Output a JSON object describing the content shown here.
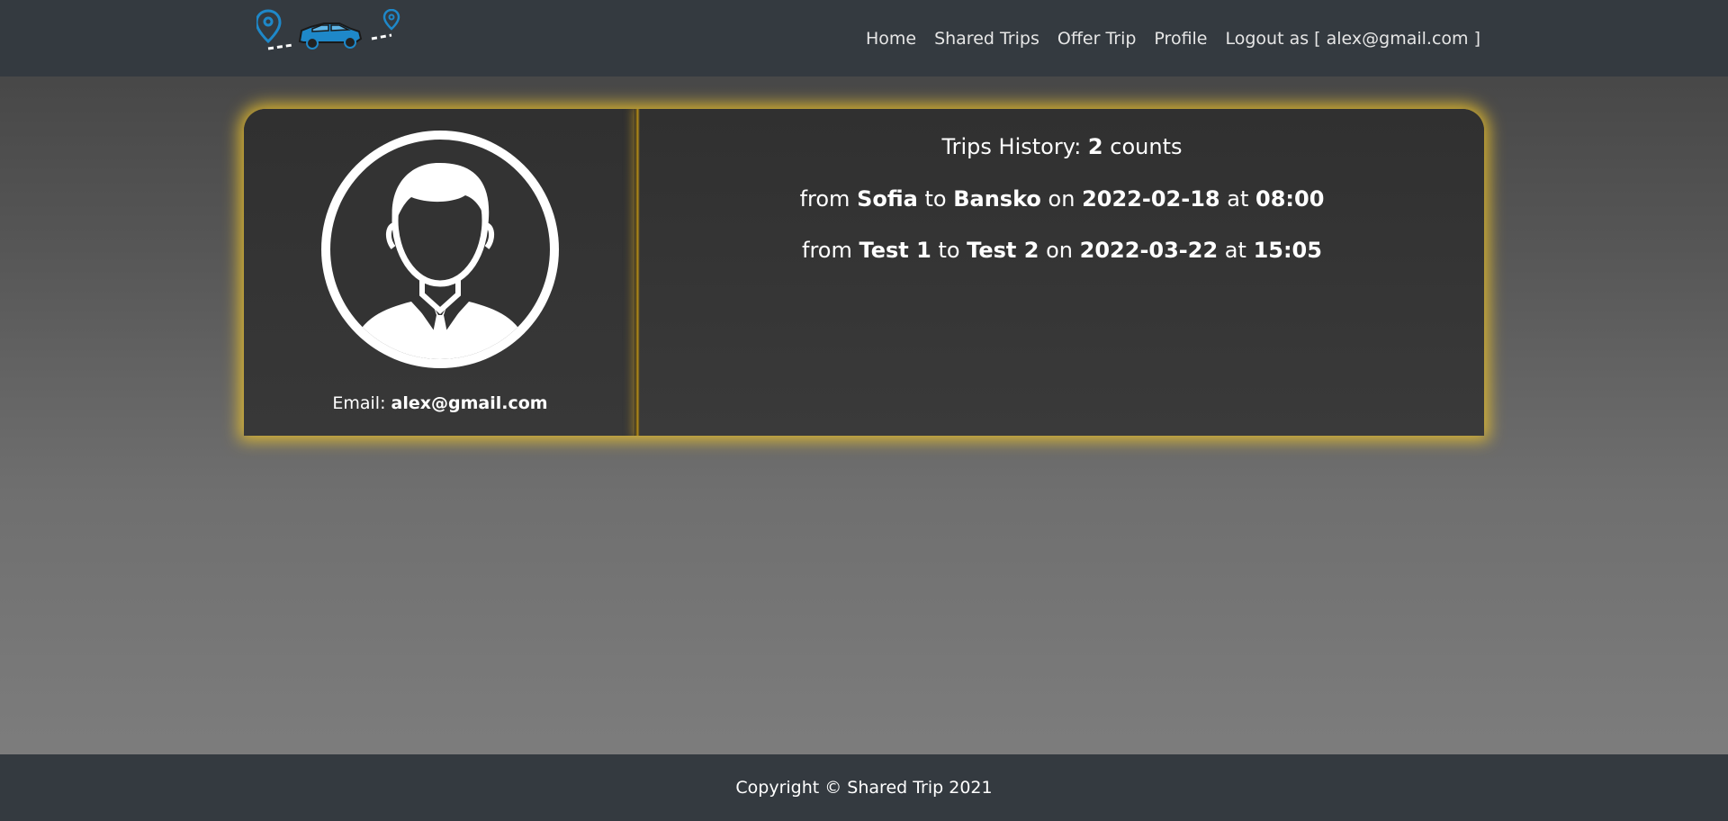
{
  "logo": {
    "icon": "car-route-logo-icon",
    "accent": "#1e88c9"
  },
  "nav": {
    "items": [
      {
        "label": "Home"
      },
      {
        "label": "Shared Trips"
      },
      {
        "label": "Offer Trip"
      },
      {
        "label": "Profile"
      },
      {
        "label": "Logout as [ alex@gmail.com ]"
      }
    ]
  },
  "profile": {
    "avatar_icon": "user-avatar-icon",
    "email_prefix": "Email:",
    "email": "alex@gmail.com"
  },
  "history": {
    "title_prefix": "Trips History:",
    "count": "2",
    "title_suffix": "counts",
    "trips": [
      {
        "from_word": "from",
        "from": "Sofia",
        "to_word": "to",
        "to": "Bansko",
        "on_word": "on",
        "date": "2022-02-18",
        "at_word": "at",
        "time": "08:00"
      },
      {
        "from_word": "from",
        "from": "Test 1",
        "to_word": "to",
        "to": "Test 2",
        "on_word": "on",
        "date": "2022-03-22",
        "at_word": "at",
        "time": "15:05"
      }
    ]
  },
  "footer": {
    "text": "Copyright © Shared Trip 2021"
  },
  "colors": {
    "navbar": "#343a40",
    "glow": "#f5c828",
    "card": "#333333"
  }
}
